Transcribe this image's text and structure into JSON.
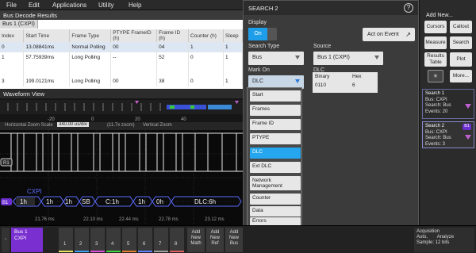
{
  "menu": {
    "file": "File",
    "edit": "Edit",
    "applications": "Applications",
    "utility": "Utility",
    "help": "Help"
  },
  "bus_results": {
    "title": "Bus Decode Results",
    "tab": "Bus 1 (CXPI)",
    "columns": [
      "Index",
      "Start Time",
      "Frame Type",
      "PTYPE FrameID (h)",
      "Frame ID (h)",
      "Counter (h)",
      "Sleep"
    ],
    "rows": [
      [
        "0",
        "13.08841ms",
        "Normal Polling",
        "00",
        "04",
        "1",
        "1"
      ],
      [
        "1",
        "57.75939ms",
        "Long Polling",
        "--",
        "52",
        "0",
        "1"
      ],
      [
        "3",
        "199.0121ms",
        "Long Polling",
        "00",
        "38",
        "0",
        "1"
      ]
    ]
  },
  "waveform": {
    "title": "Waveform View",
    "zoom_label": "Horizontal Zoom Scale",
    "zoom_value": "340.00 us/div",
    "zoom_extra": "(11.7x zoom)",
    "vertical_zoom": "Vertical Zoom",
    "overview_ticks": [
      "-20",
      "0",
      "20",
      "40"
    ],
    "bus_name": "CXPI",
    "bus_badge": "B1",
    "ref_badge": "R1",
    "packets": [
      "1h",
      "1h",
      "1h",
      "SB",
      "C:1h",
      "1h",
      "0h",
      "DLC:6h"
    ],
    "time_ticks": [
      "21.76 ms",
      "22.10 ms",
      "22.44 ms",
      "22.78 ms",
      "23.12 ms"
    ]
  },
  "search": {
    "title": "SEARCH 2",
    "help": "?",
    "display_label": "Display",
    "display_on": "On",
    "act_on_event": "Act on Event",
    "search_type_label": "Search Type",
    "search_type_value": "Bus",
    "source_label": "Source",
    "source_value": "Bus 1 (CXPI)",
    "mark_on_label": "Mark On",
    "mark_on_value": "DLC",
    "dlc_label": "DLC",
    "binary_label": "Binary",
    "binary_value": "0110",
    "hex_label": "Hex",
    "hex_value": "6",
    "options": [
      "Start",
      "Frames",
      "Frame ID",
      "PTYPE",
      "DLC",
      "Ext DLC",
      "Network Management",
      "Counter",
      "Data",
      "Errors"
    ],
    "active_option": "DLC"
  },
  "right_panel": {
    "add_new": "Add New...",
    "cursors": "Cursors",
    "callout": "Callout",
    "measure": "Measure",
    "search": "Search",
    "results_table": "Results Table",
    "plot": "Plot",
    "more": "More...",
    "search1": {
      "title": "Search 1",
      "bus": "Bus: CXPI",
      "search": "Search: Bus",
      "events": "Events: 20"
    },
    "search2": {
      "title": "Search 2",
      "badge": "B1",
      "bus": "Bus: CXPI",
      "search": "Search: Bus",
      "events": "Events: 3"
    }
  },
  "bottom": {
    "bus_label": "Bus 1",
    "bus_sub": "CXPI",
    "channels": [
      "1",
      "2",
      "3",
      "4",
      "5",
      "6",
      "7",
      "8"
    ],
    "add_math": "Add New Math",
    "add_ref": "Add New Ref",
    "add_bus": "Add New Bus",
    "acq_title": "Acquisition",
    "acq_line1": "Auto,",
    "acq_line2": "Analyze",
    "acq_line3": "Sample: 12 bits"
  }
}
